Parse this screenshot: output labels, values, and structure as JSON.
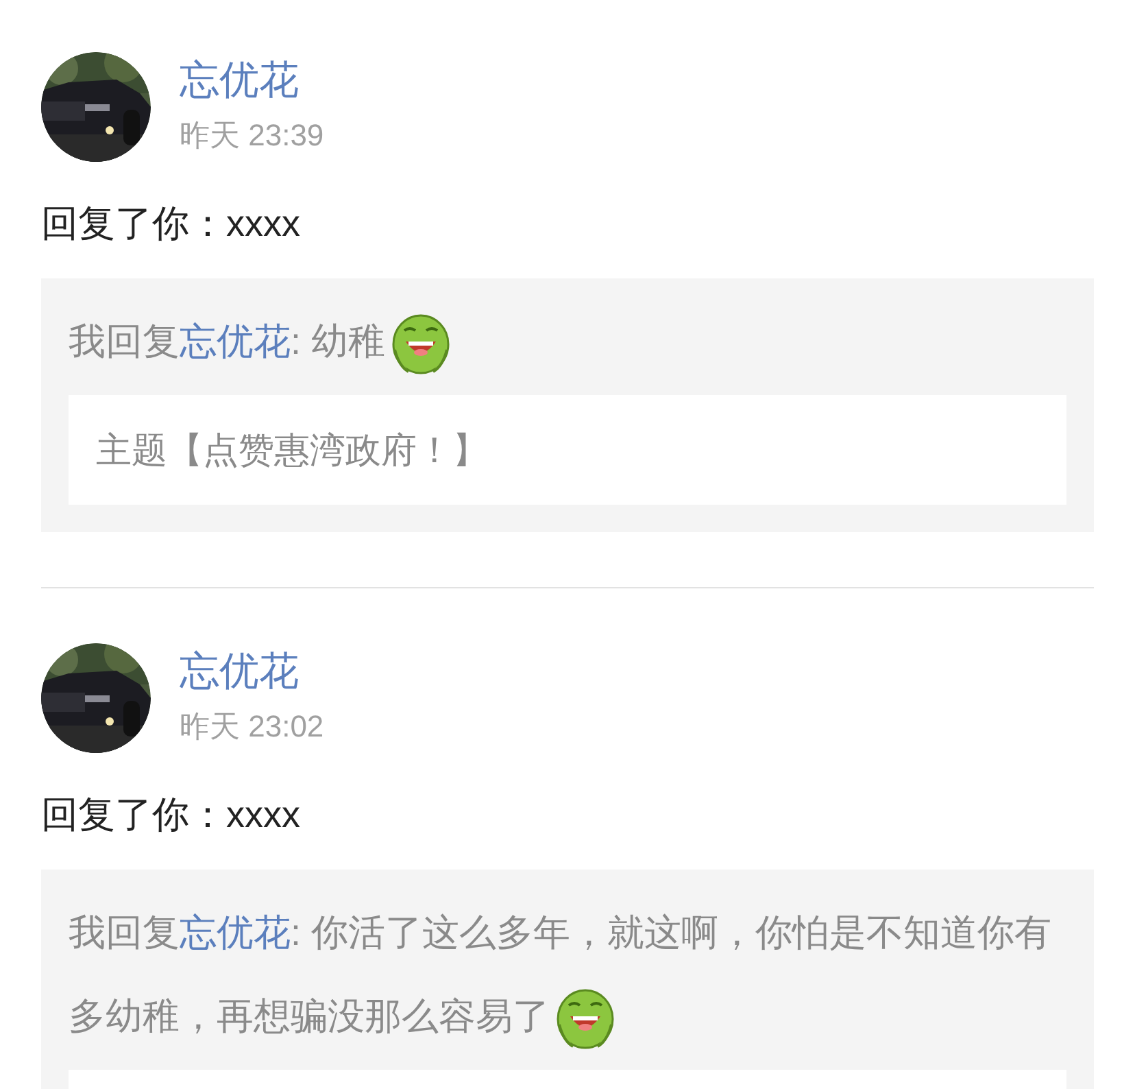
{
  "notifications": [
    {
      "author": "忘优花",
      "time": "昨天 23:39",
      "message": "回复了你：xxxx",
      "quote": {
        "prefix": "我回复",
        "target": "忘优花",
        "text": ": 幼稚",
        "emoji": true,
        "topic": "主题【点赞惠湾政府！】"
      }
    },
    {
      "author": "忘优花",
      "time": "昨天 23:02",
      "message": "回复了你：xxxx",
      "quote": {
        "prefix": "我回复",
        "target": "忘优花",
        "text": ": 你活了这么多年，就这啊，你怕是不知道你有多幼稚，再想骗没那么容易了",
        "emoji": true
      }
    }
  ]
}
